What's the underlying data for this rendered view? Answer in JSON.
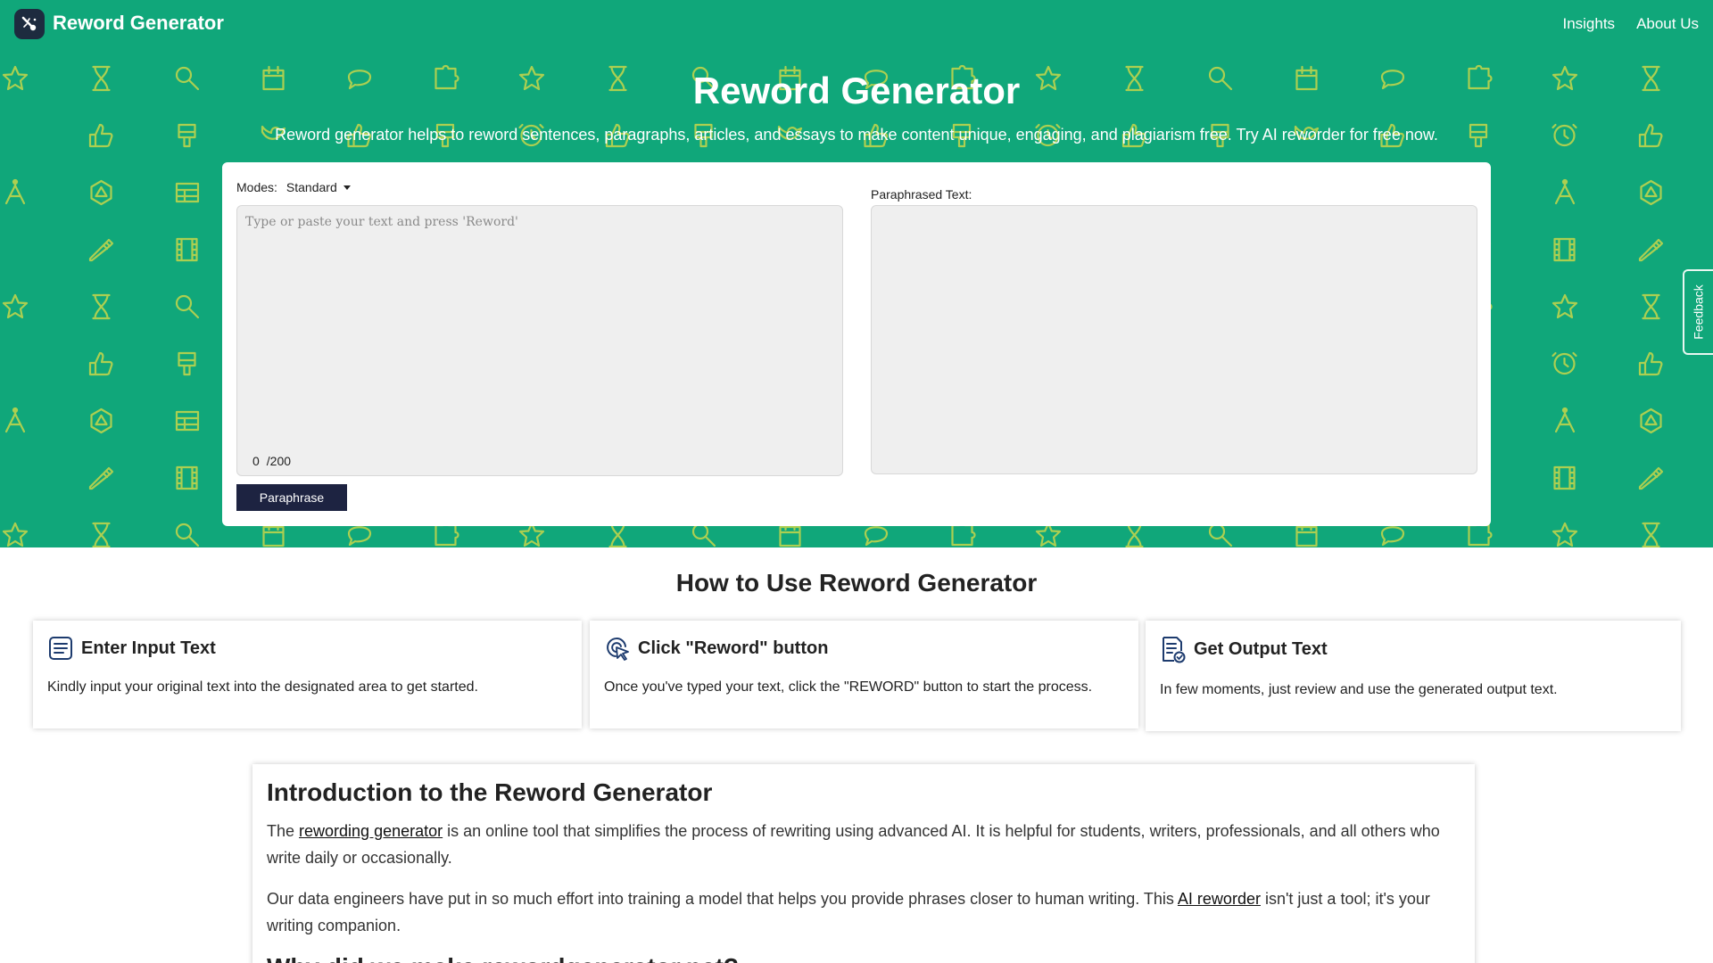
{
  "header": {
    "brand": "Reword Generator",
    "nav": [
      "Insights",
      "About Us"
    ]
  },
  "hero": {
    "title": "Reword Generator",
    "subtitle": "Reword generator helps to reword sentences, paragraphs, articles, and essays to make content unique, engaging, and plagiarism free. Try AI reworder for free now."
  },
  "tool": {
    "modes_label": "Modes:",
    "mode_value": "Standard",
    "input_placeholder": "Type or paste your text and press 'Reword'",
    "counter_count": "0",
    "counter_limit": "/200",
    "output_label": "Paraphrased Text:",
    "button_label": "Paraphrase"
  },
  "feedback": "Feedback",
  "how": {
    "title": "How to Use Reword Generator",
    "steps": [
      {
        "title": "Enter Input Text",
        "text": "Kindly input your original text into the designated area to get started.",
        "icon": "text-lines-icon"
      },
      {
        "title": "Click \"Reword\" button",
        "text": "Once you've typed your text, click the \"REWORD\" button to start the process.",
        "icon": "cursor-click-icon"
      },
      {
        "title": "Get Output Text",
        "text": "In few moments, just review and use the generated output text.",
        "icon": "document-check-icon"
      }
    ]
  },
  "intro": {
    "title": "Introduction to the Reword Generator",
    "p1_before": "The ",
    "p1_link": "rewording generator",
    "p1_after": " is an online tool that simplifies the process of rewriting using advanced AI. It is helpful for students, writers, professionals, and all others who write daily or occasionally.",
    "p2_before": "Our data engineers have put in so much effort into training a model that helps you provide phrases closer to human writing. This ",
    "p2_link": "AI reworder",
    "p2_after": " isn't just a tool; it's your writing companion.",
    "next_heading": "Why did we make rewordgenerator.net?"
  },
  "colors": {
    "hero_bg": "#10a77a",
    "pattern": "#c8d64a",
    "button_bg": "#1d2341",
    "logo_bg": "#1d2b3f"
  }
}
